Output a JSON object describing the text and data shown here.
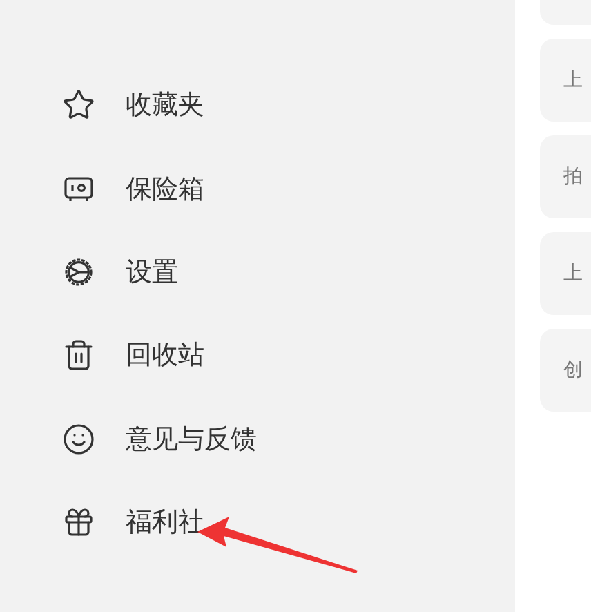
{
  "menu": [
    {
      "kind": "star",
      "label": "收藏夹"
    },
    {
      "kind": "safe",
      "label": "保险箱"
    },
    {
      "kind": "settings",
      "label": "设置"
    },
    {
      "kind": "trash",
      "label": "回收站"
    },
    {
      "kind": "feedback",
      "label": "意见与反馈"
    },
    {
      "kind": "gift",
      "label": "福利社"
    }
  ],
  "cards": [
    {
      "text": "上"
    },
    {
      "text": "拍"
    },
    {
      "text": "上"
    },
    {
      "text": "创"
    }
  ]
}
